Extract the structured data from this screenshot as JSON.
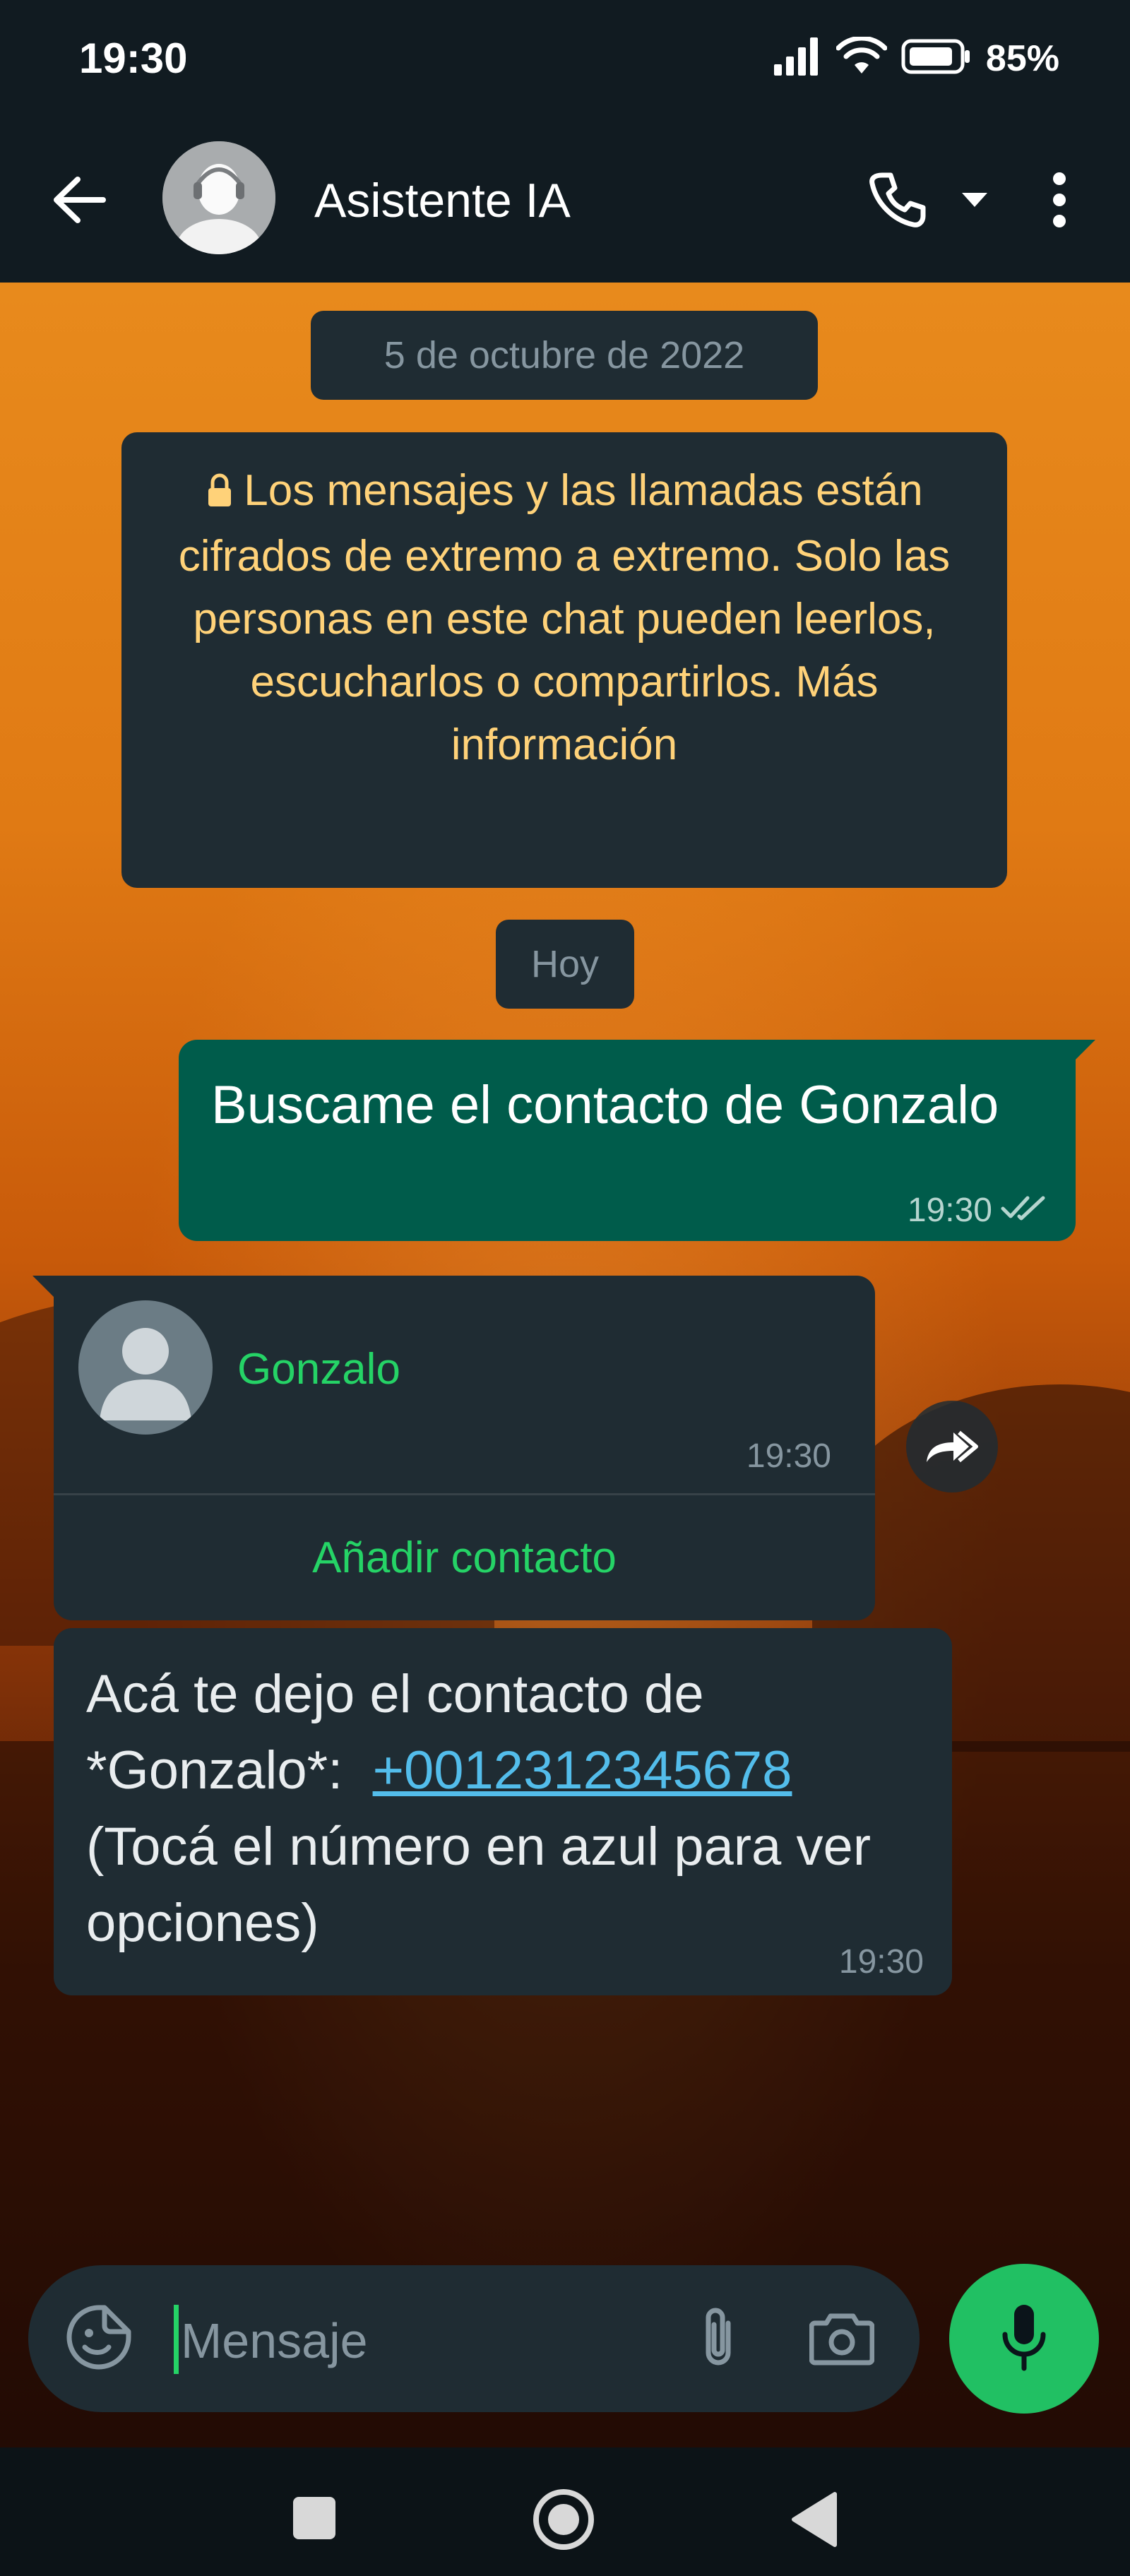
{
  "status_bar": {
    "time": "19:30",
    "battery": "85%"
  },
  "header": {
    "title": "Asistente IA",
    "avatar_icon": "robot-assistant-avatar",
    "icons": [
      "back-arrow-icon",
      "phone-icon",
      "dropdown-caret-icon",
      "more-vert-icon"
    ]
  },
  "chat": {
    "date_label": "5 de octubre de 2022",
    "encryption_notice": "Los mensajes y las llamadas están cifrados de extremo a extremo. Solo las personas en este chat pueden leerlos, escucharlos o compartirlos. Más información",
    "today_label": "Hoy",
    "messages": [
      {
        "direction": "outgoing",
        "text": "Buscame el contacto de Gonzalo",
        "time": "19:30",
        "status": "read"
      },
      {
        "direction": "incoming",
        "type": "contact",
        "contact_name": "Gonzalo",
        "time": "19:30",
        "action": "Añadir contacto"
      },
      {
        "direction": "incoming",
        "text_before": "Acá te dejo el contacto de *Gonzalo*:",
        "phone": "+0012312345678",
        "text_after": "(Tocá el número en azul para ver opciones)",
        "time": "19:30"
      }
    ]
  },
  "composer": {
    "placeholder": "Mensaje",
    "icons": [
      "sticker-icon",
      "attach-icon",
      "camera-icon",
      "microphone-icon"
    ]
  },
  "colors": {
    "header_bg": "#111b21",
    "bubble_out": "#005c4b",
    "bubble_in": "#1f2c33",
    "accent_green": "#25d366",
    "link_blue": "#53bdeb",
    "notice_text": "#ffd279"
  }
}
